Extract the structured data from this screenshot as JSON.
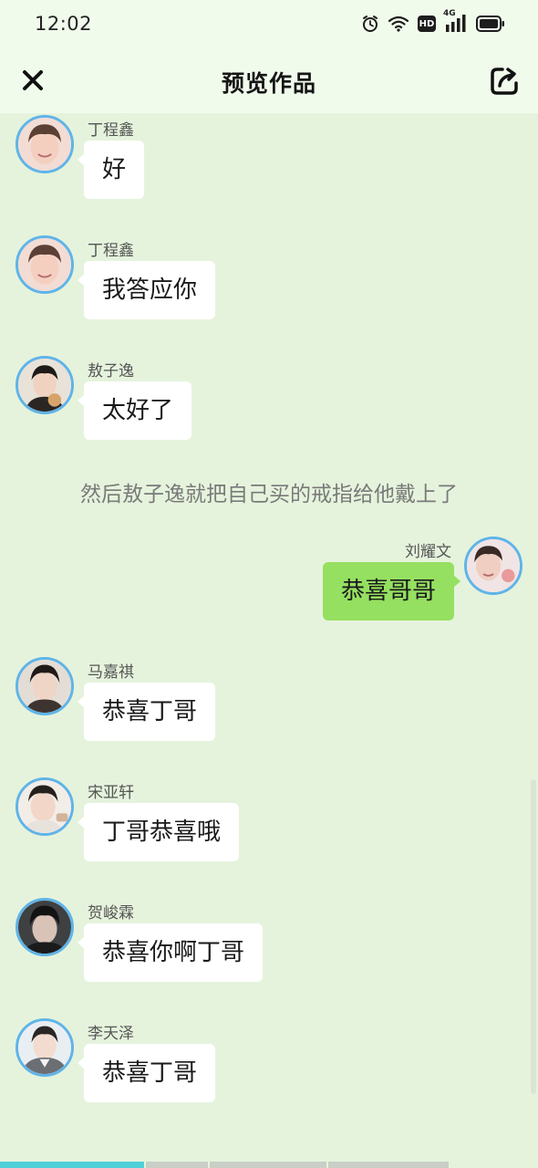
{
  "status_bar": {
    "time": "12:02",
    "icons": [
      "alarm-icon",
      "wifi-icon",
      "hd-icon",
      "signal-icon",
      "battery-icon"
    ],
    "hd_label": "HD",
    "network_label": "4G"
  },
  "header": {
    "title": "预览作品",
    "close_icon": "close-icon",
    "share_icon": "share-icon"
  },
  "messages": [
    {
      "type": "left",
      "name": "丁程鑫",
      "text": "好"
    },
    {
      "type": "left",
      "name": "丁程鑫",
      "text": "我答应你"
    },
    {
      "type": "left",
      "name": "敖子逸",
      "text": "太好了"
    },
    {
      "type": "narration",
      "text": "然后敖子逸就把自己买的戒指给他戴上了"
    },
    {
      "type": "right",
      "name": "刘耀文",
      "text": "恭喜哥哥"
    },
    {
      "type": "left",
      "name": "马嘉祺",
      "text": "恭喜丁哥"
    },
    {
      "type": "left",
      "name": "宋亚轩",
      "text": "丁哥恭喜哦"
    },
    {
      "type": "left",
      "name": "贺峻霖",
      "text": "恭喜你啊丁哥"
    },
    {
      "type": "left",
      "name": "李天泽",
      "text": "恭喜丁哥"
    }
  ],
  "colors": {
    "chat_background": "#e5f3dc",
    "header_background": "#f1fbec",
    "bubble_left": "#ffffff",
    "bubble_right": "#95e060",
    "avatar_border": "#5fb4e8",
    "progress_active": "#4fd0d8"
  }
}
